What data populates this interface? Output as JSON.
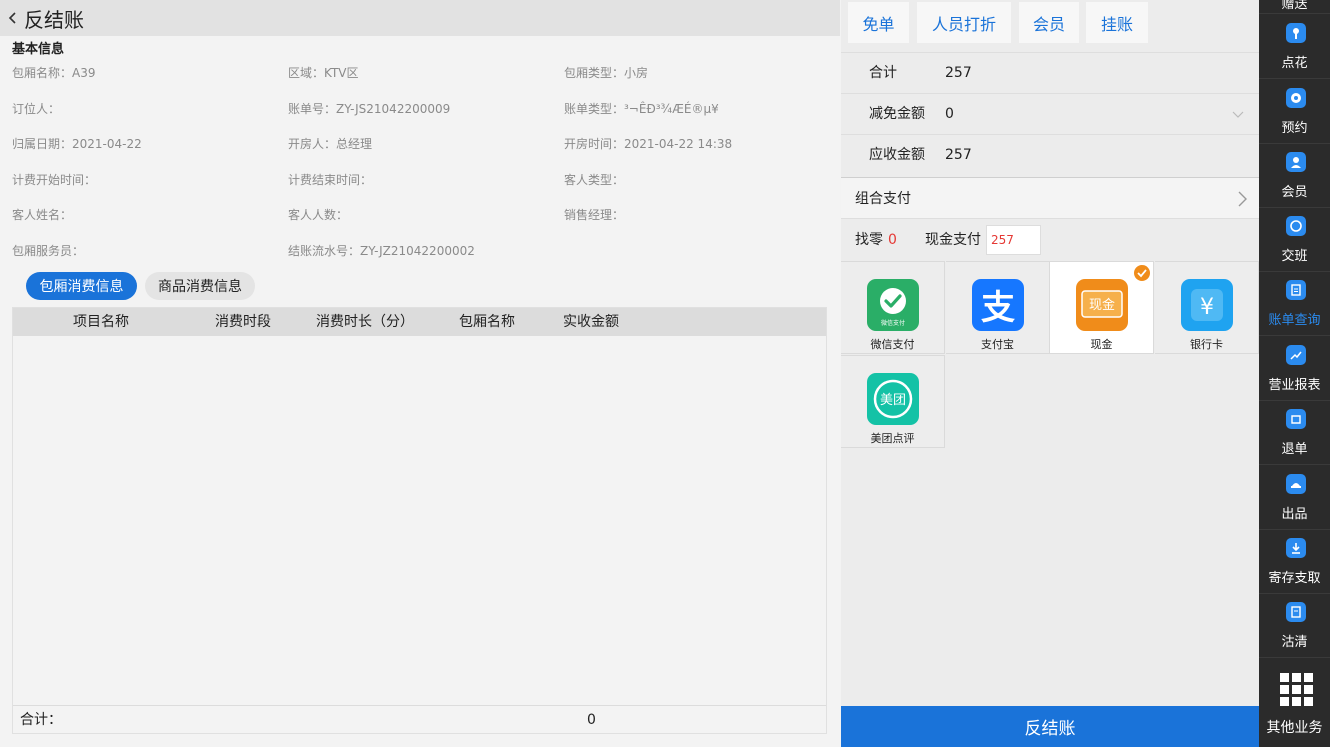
{
  "page": {
    "title": "反结账",
    "section_title": "基本信息"
  },
  "info": {
    "room_name": "包厢名称：A39",
    "area": "区域：KTV区",
    "room_type": "包厢类型：小房",
    "booker": "订位人：",
    "bill_no": "账单号：ZY-JS21042200009",
    "bill_type": "账单类型：³¬ÊÐ³¾ÆÉ®µ¥",
    "owner_date": "归属日期：2021-04-22",
    "opener": "开房人：总经理",
    "open_time": "开房时间：2021-04-22 14:38",
    "bill_start": "计费开始时间：",
    "bill_end": "计费结束时间：",
    "guest_type": "客人类型：",
    "guest_name": "客人姓名：",
    "guest_count": "客人人数：",
    "sales_manager": "销售经理：",
    "room_waiter": "包厢服务员：",
    "settle_no": "结账流水号：ZY-JZ21042200002"
  },
  "tabs": {
    "room": "包厢消费信息",
    "goods": "商品消费信息"
  },
  "table": {
    "headers": [
      "项目名称",
      "消费时段",
      "消费时长（分）",
      "包厢名称",
      "实收金额"
    ],
    "footer_label": "合计：",
    "footer_value": "0"
  },
  "actions": {
    "free": "免单",
    "staff_discount": "人员打折",
    "member": "会员",
    "credit": "挂账"
  },
  "summary": {
    "total_label": "合计",
    "total_value": "257",
    "discount_label": "减免金额",
    "discount_value": "0",
    "due_label": "应收金额",
    "due_value": "257"
  },
  "combo_pay": "组合支付",
  "change": {
    "label": "找零",
    "value": "0",
    "cash_label": "现金支付",
    "cash_value": "257"
  },
  "payments": [
    {
      "label": "微信支付",
      "icon": "wechat-pay-icon",
      "icon_text": "微信支付",
      "color": "#2aae67"
    },
    {
      "label": "支付宝",
      "icon": "alipay-icon",
      "icon_text": "支",
      "color": "#1677ff"
    },
    {
      "label": "现金",
      "icon": "cash-icon",
      "icon_text": "现金",
      "color": "#f08c1a",
      "selected": true
    },
    {
      "label": "银行卡",
      "icon": "bank-card-icon",
      "icon_text": "¥",
      "color": "#1fa3f0"
    },
    {
      "label": "美团点评",
      "icon": "meituan-icon",
      "icon_text": "美团",
      "color": "#14c2a6"
    }
  ],
  "checkout_button": "反结账",
  "sidebar": {
    "top_partial": "赠送",
    "items": [
      {
        "label": "点花",
        "icon": "flower-icon"
      },
      {
        "label": "预约",
        "icon": "reservation-icon"
      },
      {
        "label": "会员",
        "icon": "member-icon"
      },
      {
        "label": "交班",
        "icon": "shift-icon"
      },
      {
        "label": "账单查询",
        "icon": "bill-query-icon",
        "active": true
      },
      {
        "label": "营业报表",
        "icon": "report-icon"
      },
      {
        "label": "退单",
        "icon": "refund-icon"
      },
      {
        "label": "出品",
        "icon": "dispatch-icon"
      },
      {
        "label": "寄存支取",
        "icon": "storage-icon"
      },
      {
        "label": "沽清",
        "icon": "sold-out-icon"
      }
    ],
    "more": "其他业务"
  },
  "colors": {
    "accent": "#1a73d9",
    "change_red": "#e53935",
    "sidebar_bg": "#2b2b2b",
    "sidebar_icon": "#2b8bef"
  }
}
